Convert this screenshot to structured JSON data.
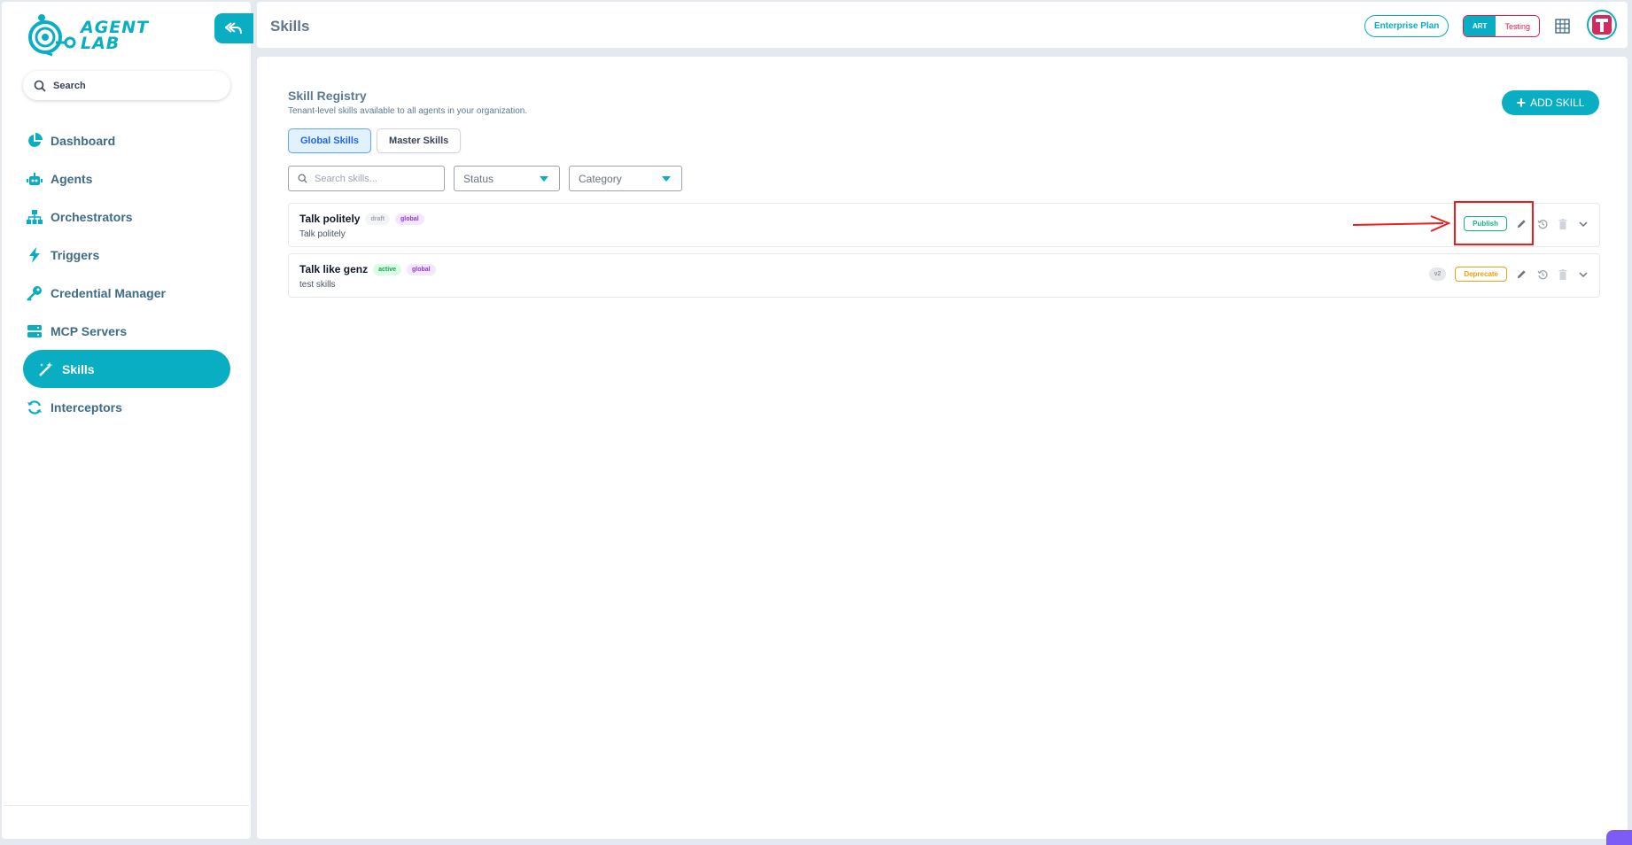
{
  "brand": {
    "line1": "AGENT",
    "line2": "LAB"
  },
  "sidebar": {
    "search_label": "Search",
    "items": [
      {
        "label": "Dashboard",
        "icon": "pie-chart-icon"
      },
      {
        "label": "Agents",
        "icon": "robot-icon"
      },
      {
        "label": "Orchestrators",
        "icon": "hierarchy-icon"
      },
      {
        "label": "Triggers",
        "icon": "lightning-icon"
      },
      {
        "label": "Credential Manager",
        "icon": "key-icon"
      },
      {
        "label": "MCP Servers",
        "icon": "server-icon"
      },
      {
        "label": "Skills",
        "icon": "magic-wand-icon",
        "active": true
      },
      {
        "label": "Interceptors",
        "icon": "refresh-icon"
      }
    ]
  },
  "header": {
    "title": "Skills",
    "plan": "Enterprise Plan",
    "env_primary": "ART",
    "env_secondary": "Testing"
  },
  "registry": {
    "title": "Skill Registry",
    "subtitle": "Tenant-level skills available to all agents in your organization.",
    "add_button": "ADD SKILL",
    "tabs": [
      {
        "label": "Global Skills",
        "active": true
      },
      {
        "label": "Master Skills"
      }
    ],
    "search_placeholder": "Search skills...",
    "status_label": "Status",
    "category_label": "Category"
  },
  "skills": [
    {
      "name": "Talk politely",
      "status": "draft",
      "scope": "global",
      "description": "Talk politely",
      "version": "",
      "action": "Publish"
    },
    {
      "name": "Talk like genz",
      "status": "active",
      "scope": "global",
      "description": "test skills",
      "version": "v2",
      "action": "Deprecate"
    }
  ],
  "colors": {
    "accent": "#0aaec3",
    "annotation": "#ef1c1c"
  }
}
